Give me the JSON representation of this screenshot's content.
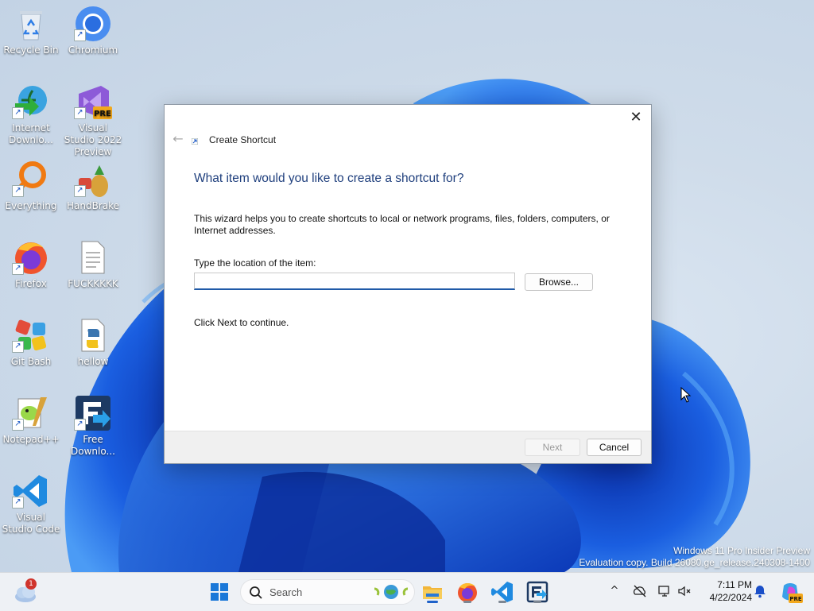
{
  "desktop": {
    "icons": [
      {
        "label": "Recycle Bin",
        "icon": "recycle-bin-icon"
      },
      {
        "label": "Chromium",
        "icon": "chromium-icon"
      },
      {
        "label": "Internet Downlo...",
        "icon": "internet-download-manager-icon"
      },
      {
        "label": "Visual Studio 2022 Preview",
        "icon": "visual-studio-preview-icon",
        "badge": "PRE"
      },
      {
        "label": "Everything",
        "icon": "everything-search-icon"
      },
      {
        "label": "HandBrake",
        "icon": "handbrake-icon"
      },
      {
        "label": "Firefox",
        "icon": "firefox-icon"
      },
      {
        "label": "FUCKKKKK",
        "icon": "text-file-icon"
      },
      {
        "label": "Git Bash",
        "icon": "git-bash-icon"
      },
      {
        "label": "hellow",
        "icon": "python-file-icon"
      },
      {
        "label": "Notepad++",
        "icon": "notepad-plus-plus-icon"
      },
      {
        "label": "Free Downlo...",
        "icon": "free-download-manager-icon"
      },
      {
        "label": "Visual Studio Code",
        "icon": "vscode-icon"
      }
    ]
  },
  "dialog": {
    "title": "Create Shortcut",
    "heading": "What item would you like to create a shortcut for?",
    "description": "This wizard helps you to create shortcuts to local or network programs, files, folders, computers, or Internet addresses.",
    "location_label": "Type the location of the item:",
    "location_value": "",
    "browse_label": "Browse...",
    "continue_text": "Click Next to continue.",
    "next_label": "Next",
    "cancel_label": "Cancel",
    "close_glyph": "✕",
    "back_glyph": "←"
  },
  "watermark": {
    "line1": "Windows 11 Pro Insider Preview",
    "line2": "Evaluation copy. Build 26080.ge_release.240308-1400"
  },
  "taskbar": {
    "weather_badge": "1",
    "search_placeholder": "Search",
    "pinned": [
      "start-icon",
      "file-explorer-icon",
      "firefox-icon",
      "vscode-icon",
      "free-download-manager-icon"
    ],
    "tray_chevron": "^",
    "time": "7:11 PM",
    "date": "4/22/2024"
  },
  "colors": {
    "accent": "#1f62c9",
    "heading": "#1f3f7d",
    "wallpaper_blue": "#1554d6"
  }
}
